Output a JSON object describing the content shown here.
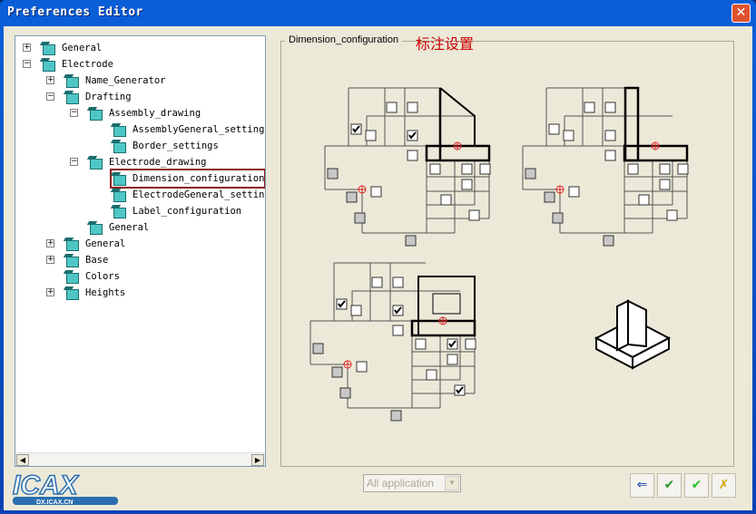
{
  "window": {
    "title": "Preferences Editor",
    "close_icon": "close-icon"
  },
  "tree": [
    {
      "label": "General",
      "level": 0,
      "exp": "+"
    },
    {
      "label": "Electrode",
      "level": 0,
      "exp": "-"
    },
    {
      "label": "Name_Generator",
      "level": 1,
      "exp": "+"
    },
    {
      "label": "Drafting",
      "level": 1,
      "exp": "-"
    },
    {
      "label": "Assembly_drawing",
      "level": 2,
      "exp": "-"
    },
    {
      "label": "AssemblyGeneral_settings",
      "level": 3,
      "exp": ""
    },
    {
      "label": "Border_settings",
      "level": 3,
      "exp": ""
    },
    {
      "label": "Electrode_drawing",
      "level": 2,
      "exp": "-"
    },
    {
      "label": "Dimension_configuration",
      "level": 3,
      "exp": "",
      "selected": true
    },
    {
      "label": "ElectrodeGeneral_setting",
      "level": 3,
      "exp": ""
    },
    {
      "label": "Label_configuration",
      "level": 3,
      "exp": ""
    },
    {
      "label": "General",
      "level": 2,
      "exp": ""
    },
    {
      "label": "General",
      "level": 1,
      "exp": "+"
    },
    {
      "label": "Base",
      "level": 1,
      "exp": "+"
    },
    {
      "label": "Colors",
      "level": 1,
      "exp": ""
    },
    {
      "label": "Heights",
      "level": 1,
      "exp": "+"
    }
  ],
  "panel": {
    "group_label": "Dimension_configuration",
    "annotation": "标注设置"
  },
  "diagrams": [
    {
      "checked": [
        false,
        false,
        true,
        false,
        true,
        false,
        false,
        false,
        false,
        false,
        false,
        false,
        false
      ]
    },
    {
      "checked": [
        false,
        false,
        false,
        false,
        false,
        false,
        false,
        false,
        false,
        false,
        false,
        false,
        false
      ]
    },
    {
      "checked": [
        false,
        false,
        true,
        false,
        true,
        false,
        false,
        true,
        false,
        false,
        false,
        true,
        false
      ]
    }
  ],
  "footer": {
    "application_select": "All application",
    "buttons": [
      "load-defaults",
      "apply-check",
      "ok-check",
      "cancel"
    ]
  },
  "logo": {
    "text": "ICAX",
    "subtext": "DX.ICAX.CN"
  },
  "colors": {
    "title_bar": "#0a5fd8",
    "selection_outline": "#8b1a1a",
    "annotation": "#cc0000"
  }
}
